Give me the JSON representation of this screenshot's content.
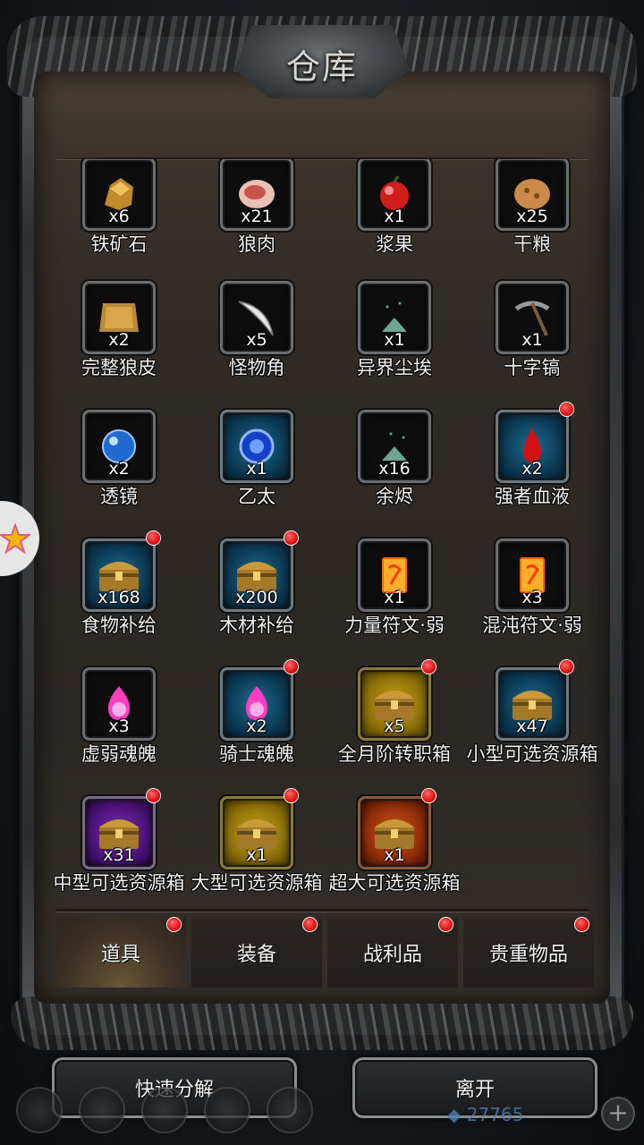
{
  "title": "仓库",
  "items": [
    {
      "name": "铁矿石",
      "qty": "x6",
      "slot": "dark",
      "icon": "iron-ore-icon",
      "dot": false
    },
    {
      "name": "狼肉",
      "qty": "x21",
      "slot": "dark",
      "icon": "meat-icon",
      "dot": false
    },
    {
      "name": "浆果",
      "qty": "x1",
      "slot": "dark",
      "icon": "berry-icon",
      "dot": false
    },
    {
      "name": "干粮",
      "qty": "x25",
      "slot": "dark",
      "icon": "bread-icon",
      "dot": false
    },
    {
      "name": "完整狼皮",
      "qty": "x2",
      "slot": "dark",
      "icon": "wolf-pelt-icon",
      "dot": false
    },
    {
      "name": "怪物角",
      "qty": "x5",
      "slot": "dark",
      "icon": "horn-icon",
      "dot": false
    },
    {
      "name": "异界尘埃",
      "qty": "x1",
      "slot": "dark",
      "icon": "dust-icon",
      "dot": false
    },
    {
      "name": "十字镐",
      "qty": "x1",
      "slot": "dark",
      "icon": "pickaxe-icon",
      "dot": false
    },
    {
      "name": "透镜",
      "qty": "x2",
      "slot": "dark",
      "icon": "lens-icon",
      "dot": false
    },
    {
      "name": "乙太",
      "qty": "x1",
      "slot": "blue",
      "icon": "ether-icon",
      "dot": false
    },
    {
      "name": "余烬",
      "qty": "x16",
      "slot": "dark",
      "icon": "ember-icon",
      "dot": false
    },
    {
      "name": "强者血液",
      "qty": "x2",
      "slot": "blue",
      "icon": "blood-drop-icon",
      "dot": true
    },
    {
      "name": "食物补给",
      "qty": "x168",
      "slot": "blue",
      "icon": "chest-icon",
      "dot": true
    },
    {
      "name": "木材补给",
      "qty": "x200",
      "slot": "blue",
      "icon": "chest-icon",
      "dot": true
    },
    {
      "name": "力量符文·弱",
      "qty": "x1",
      "slot": "dark",
      "icon": "rune-scroll-icon",
      "dot": false
    },
    {
      "name": "混沌符文·弱",
      "qty": "x3",
      "slot": "dark",
      "icon": "rune-scroll-icon",
      "dot": false
    },
    {
      "name": "虚弱魂魄",
      "qty": "x3",
      "slot": "dark",
      "icon": "soul-flame-icon",
      "dot": false
    },
    {
      "name": "骑士魂魄",
      "qty": "x2",
      "slot": "blue",
      "icon": "soul-flame-icon",
      "dot": true
    },
    {
      "name": "全月阶转职箱",
      "qty": "x5",
      "slot": "gold",
      "icon": "chest-icon",
      "dot": true
    },
    {
      "name": "小型可选资源箱",
      "qty": "x47",
      "slot": "blue",
      "icon": "chest-icon",
      "dot": true
    },
    {
      "name": "中型可选资源箱",
      "qty": "x31",
      "slot": "purple",
      "icon": "chest-icon",
      "dot": true
    },
    {
      "name": "大型可选资源箱",
      "qty": "x1",
      "slot": "gold",
      "icon": "chest-icon",
      "dot": true
    },
    {
      "name": "超大可选资源箱",
      "qty": "x1",
      "slot": "orange",
      "icon": "chest-icon",
      "dot": true
    }
  ],
  "tabs": [
    {
      "label": "道具",
      "active": true,
      "dot": true
    },
    {
      "label": "装备",
      "active": false,
      "dot": true
    },
    {
      "label": "战利品",
      "active": false,
      "dot": true
    },
    {
      "label": "贵重物品",
      "active": false,
      "dot": true
    }
  ],
  "buttons": {
    "quick_decompose": "快速分解",
    "leave": "离开"
  },
  "hud": {
    "gems": "27765"
  }
}
